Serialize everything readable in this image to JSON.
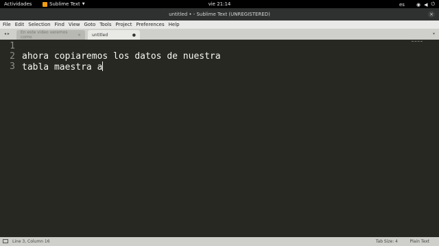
{
  "topbar": {
    "activities": "Actividades",
    "app_name": "Sublime Text",
    "clock": "vie 21:14",
    "language": "es",
    "icons": [
      "wifi-icon",
      "volume-icon",
      "power-icon"
    ]
  },
  "window": {
    "title": "untitled • - Sublime Text (UNREGISTERED)",
    "close_glyph": "×"
  },
  "menu": [
    "File",
    "Edit",
    "Selection",
    "Find",
    "View",
    "Goto",
    "Tools",
    "Project",
    "Preferences",
    "Help"
  ],
  "tabs": [
    {
      "label": "En este video veremos como",
      "close": "×"
    },
    {
      "label": "untitled",
      "close": "●"
    }
  ],
  "tabbar": {
    "nav_left": "◂ ▸",
    "nav_right": "▾"
  },
  "editor": {
    "line_numbers": [
      "1",
      "2",
      "3"
    ],
    "lines": [
      "",
      "ahora copiaremos los datos de nuestra",
      "tabla maestra a"
    ]
  },
  "status": {
    "position": "Line 3, Column 16",
    "tab_size": "Tab Size: 4",
    "syntax": "Plain Text"
  },
  "colors": {
    "editor_bg": "#272822",
    "text": "#f8f8f2",
    "gutter": "#8f908a"
  }
}
